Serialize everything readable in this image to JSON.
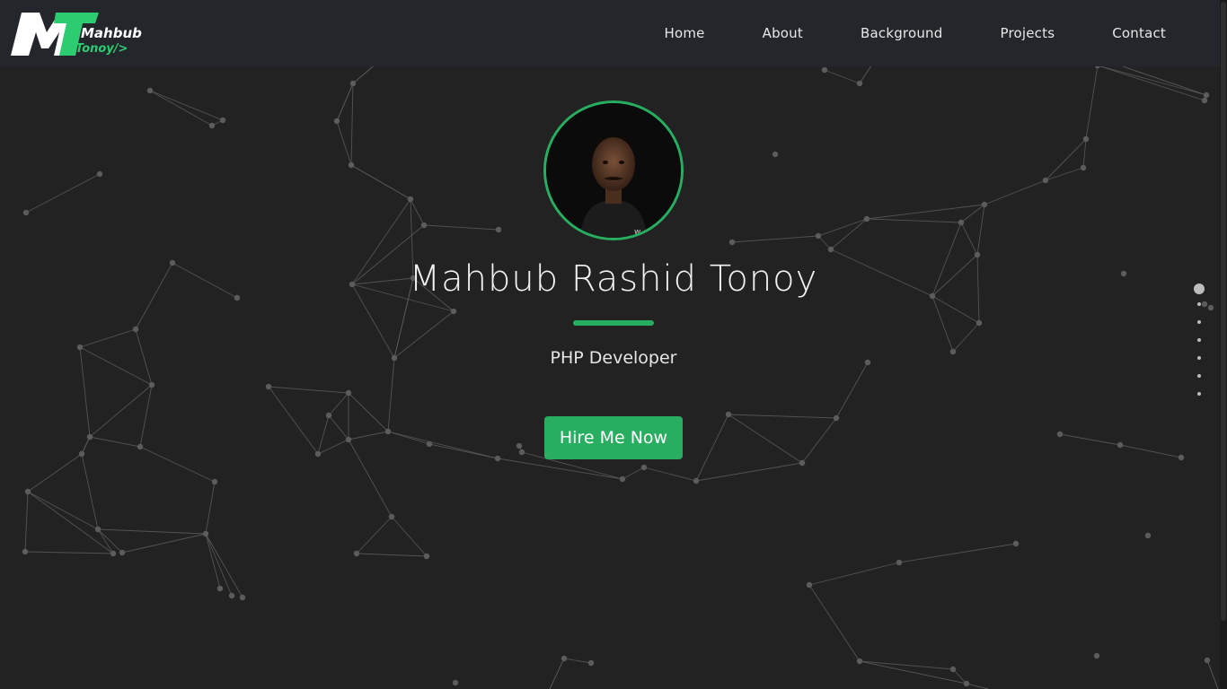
{
  "logo": {
    "text_line1": "Mahbub",
    "text_line2": "Tonoy/>",
    "monogram": "MT",
    "colors": {
      "accent": "#2ecc71",
      "white": "#ffffff"
    }
  },
  "nav": {
    "items": [
      {
        "label": "Home"
      },
      {
        "label": "About"
      },
      {
        "label": "Background"
      },
      {
        "label": "Projects"
      },
      {
        "label": "Contact"
      }
    ]
  },
  "hero": {
    "name": "Mahbub Rashid Tonoy",
    "role": "PHP Developer",
    "cta_label": "Hire Me Now",
    "avatar_icon": "profile-photo"
  },
  "section_dots": {
    "count": 7,
    "active_index": 0
  },
  "colors": {
    "background": "#222222",
    "navbar": "#23262b",
    "accent": "#27ae60",
    "network": "#5c5c5c"
  }
}
